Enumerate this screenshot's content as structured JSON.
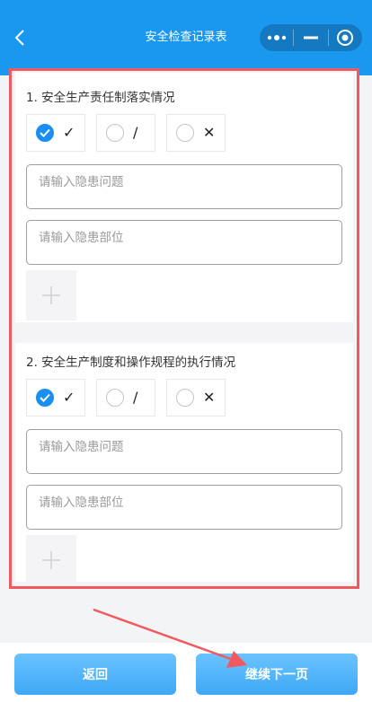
{
  "header": {
    "title": "安全检查记录表"
  },
  "questions": [
    {
      "title": "1. 安全生产责任制落实情况",
      "options": [
        "✓",
        "/",
        "✕"
      ],
      "selected": 0,
      "issue_placeholder": "请输入隐患问题",
      "location_placeholder": "请输入隐患部位"
    },
    {
      "title": "2. 安全生产制度和操作规程的执行情况",
      "options": [
        "✓",
        "/",
        "✕"
      ],
      "selected": 0,
      "issue_placeholder": "请输入隐患问题",
      "location_placeholder": "请输入隐患部位"
    }
  ],
  "footer": {
    "back_label": "返回",
    "next_label": "继续下一页"
  },
  "colors": {
    "primary": "#1a98f0",
    "highlight": "#f05a5f"
  }
}
